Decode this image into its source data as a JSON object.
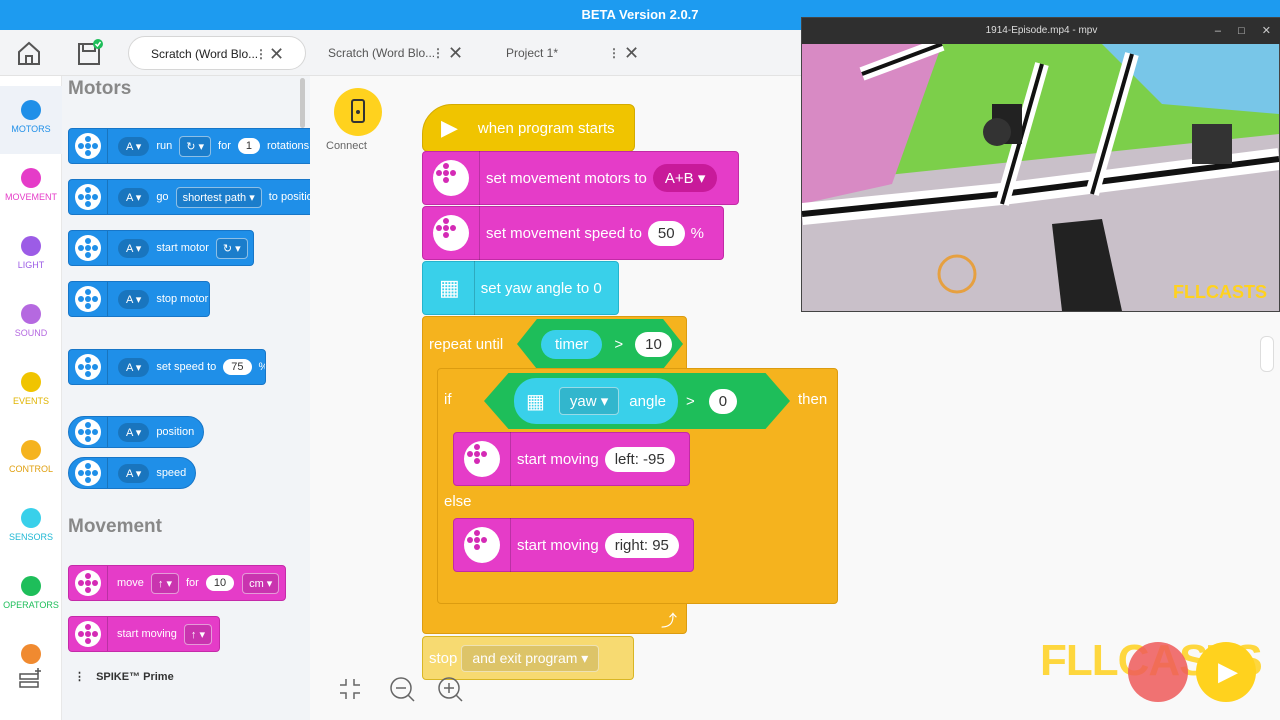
{
  "app": {
    "title": "BETA Version 2.0.7"
  },
  "tabs": [
    {
      "label": "Scratch (Word Blo...",
      "active": true
    },
    {
      "label": "Scratch (Word Blo...",
      "active": false
    },
    {
      "label": "Project 1*",
      "active": false
    }
  ],
  "tab_dots": "⋮",
  "close_glyph": "✕",
  "categories": [
    {
      "label": "MOTORS",
      "color": "#1f8fe8"
    },
    {
      "label": "MOVEMENT",
      "color": "#e53cc8"
    },
    {
      "label": "LIGHT",
      "color": "#9c5ce6"
    },
    {
      "label": "SOUND",
      "color": "#b569e0"
    },
    {
      "label": "EVENTS",
      "color": "#f0c400"
    },
    {
      "label": "CONTROL",
      "color": "#f5b31e"
    },
    {
      "label": "SENSORS",
      "color": "#39d0ea"
    },
    {
      "label": "OPERATORS",
      "color": "#1ebe5a"
    }
  ],
  "hub_label": "SPIKE™ Prime",
  "palette": {
    "motors_title": "Motors",
    "movement_title": "Movement",
    "port": "A",
    "run": "run",
    "for": "for",
    "one": "1",
    "rotations": "rotations",
    "go": "go",
    "shortest_path": "shortest path",
    "to_position": "to position",
    "start_motor": "start motor",
    "stop_motor": "stop motor",
    "set_speed_to": "set speed to",
    "speed_val": "75",
    "percent": "%",
    "position": "position",
    "speed": "speed",
    "move": "move",
    "move_val": "10",
    "cm": "cm",
    "start_moving": "start moving"
  },
  "canvas": {
    "connect_label": "Connect",
    "when_program_starts": "when program starts",
    "set_movement_motors_to": "set movement motors to",
    "motors_value": "A+B",
    "set_movement_speed_to": "set movement speed to",
    "speed_value": "50",
    "percent": "%",
    "set_yaw_angle_to_0": "set yaw angle to 0",
    "repeat_until": "repeat until",
    "timer": "timer",
    "gt": ">",
    "timer_value": "10",
    "if": "if",
    "yaw": "yaw",
    "angle": "angle",
    "angle_value": "0",
    "then": "then",
    "start_moving": "start moving",
    "left_value": "left: -95",
    "else": "else",
    "right_value": "right: 95",
    "stop": "stop",
    "and_exit_program": "and exit program"
  },
  "video": {
    "title": "1914-Episode.mp4 - mpv",
    "watermark": "FLLCASTS"
  },
  "watermark": "FLLCASTS"
}
